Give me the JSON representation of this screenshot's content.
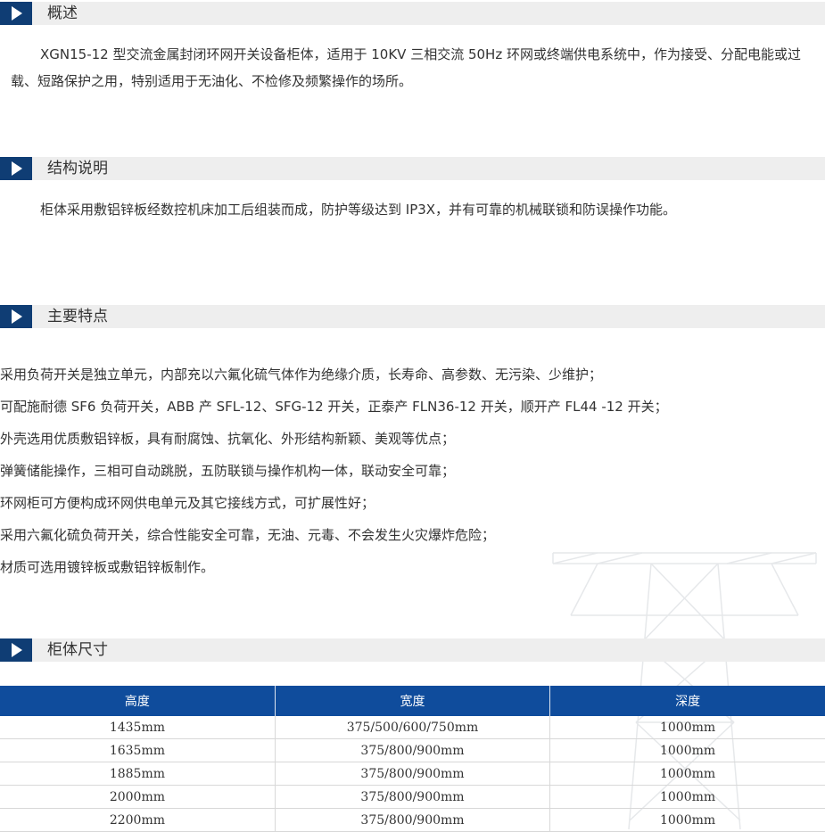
{
  "sections": {
    "overview": {
      "title": "概述",
      "text": "XGN15-12 型交流金属封闭环网开关设备柜体，适用于 10KV 三相交流 50Hz 环网或终端供电系统中，作为接受、分配电能或过载、短路保护之用，特别适用于无油化、不检修及频繁操作的场所。"
    },
    "structure": {
      "title": "结构说明",
      "text": "柜体采用敷铝锌板经数控机床加工后组装而成，防护等级达到 IP3X，并有可靠的机械联锁和防误操作功能。"
    },
    "features": {
      "title": "主要特点",
      "items": [
        "采用负荷开关是独立单元，内部充以六氟化硫气体作为绝缘介质，长寿命、高参数、无污染、少维护；",
        "可配施耐德 SF6 负荷开关，ABB 产 SFL-12、SFG-12 开关，正泰产 FLN36-12 开关，顺开产 FL44 -12 开关；",
        "外壳选用优质敷铝锌板，具有耐腐蚀、抗氧化、外形结构新颖、美观等优点；",
        "弹簧储能操作，三相可自动跳脱，五防联锁与操作机构一体，联动安全可靠；",
        "环网柜可方便构成环网供电单元及其它接线方式，可扩展性好；",
        "采用六氟化硫负荷开关，综合性能安全可靠，无油、元毒、不会发生火灾爆炸危险；",
        "材质可选用镀锌板或敷铝锌板制作。"
      ]
    },
    "dimensions": {
      "title": "柜体尺寸",
      "headers": [
        "高度",
        "宽度",
        "深度"
      ],
      "rows": [
        [
          "1435mm",
          "375/500/600/750mm",
          "1000mm"
        ],
        [
          "1635mm",
          "375/800/900mm",
          "1000mm"
        ],
        [
          "1885mm",
          "375/800/900mm",
          "1000mm"
        ],
        [
          "2000mm",
          "375/800/900mm",
          "1000mm"
        ],
        [
          "2200mm",
          "375/800/900mm",
          "1000mm"
        ]
      ]
    }
  },
  "colors": {
    "header_icon": "#0f3d74",
    "header_bar": "#eeeeee",
    "table_header": "#0f4c9c"
  },
  "icons": {
    "section_marker": "play-arrow-icon",
    "background": "power-tower-icon"
  }
}
